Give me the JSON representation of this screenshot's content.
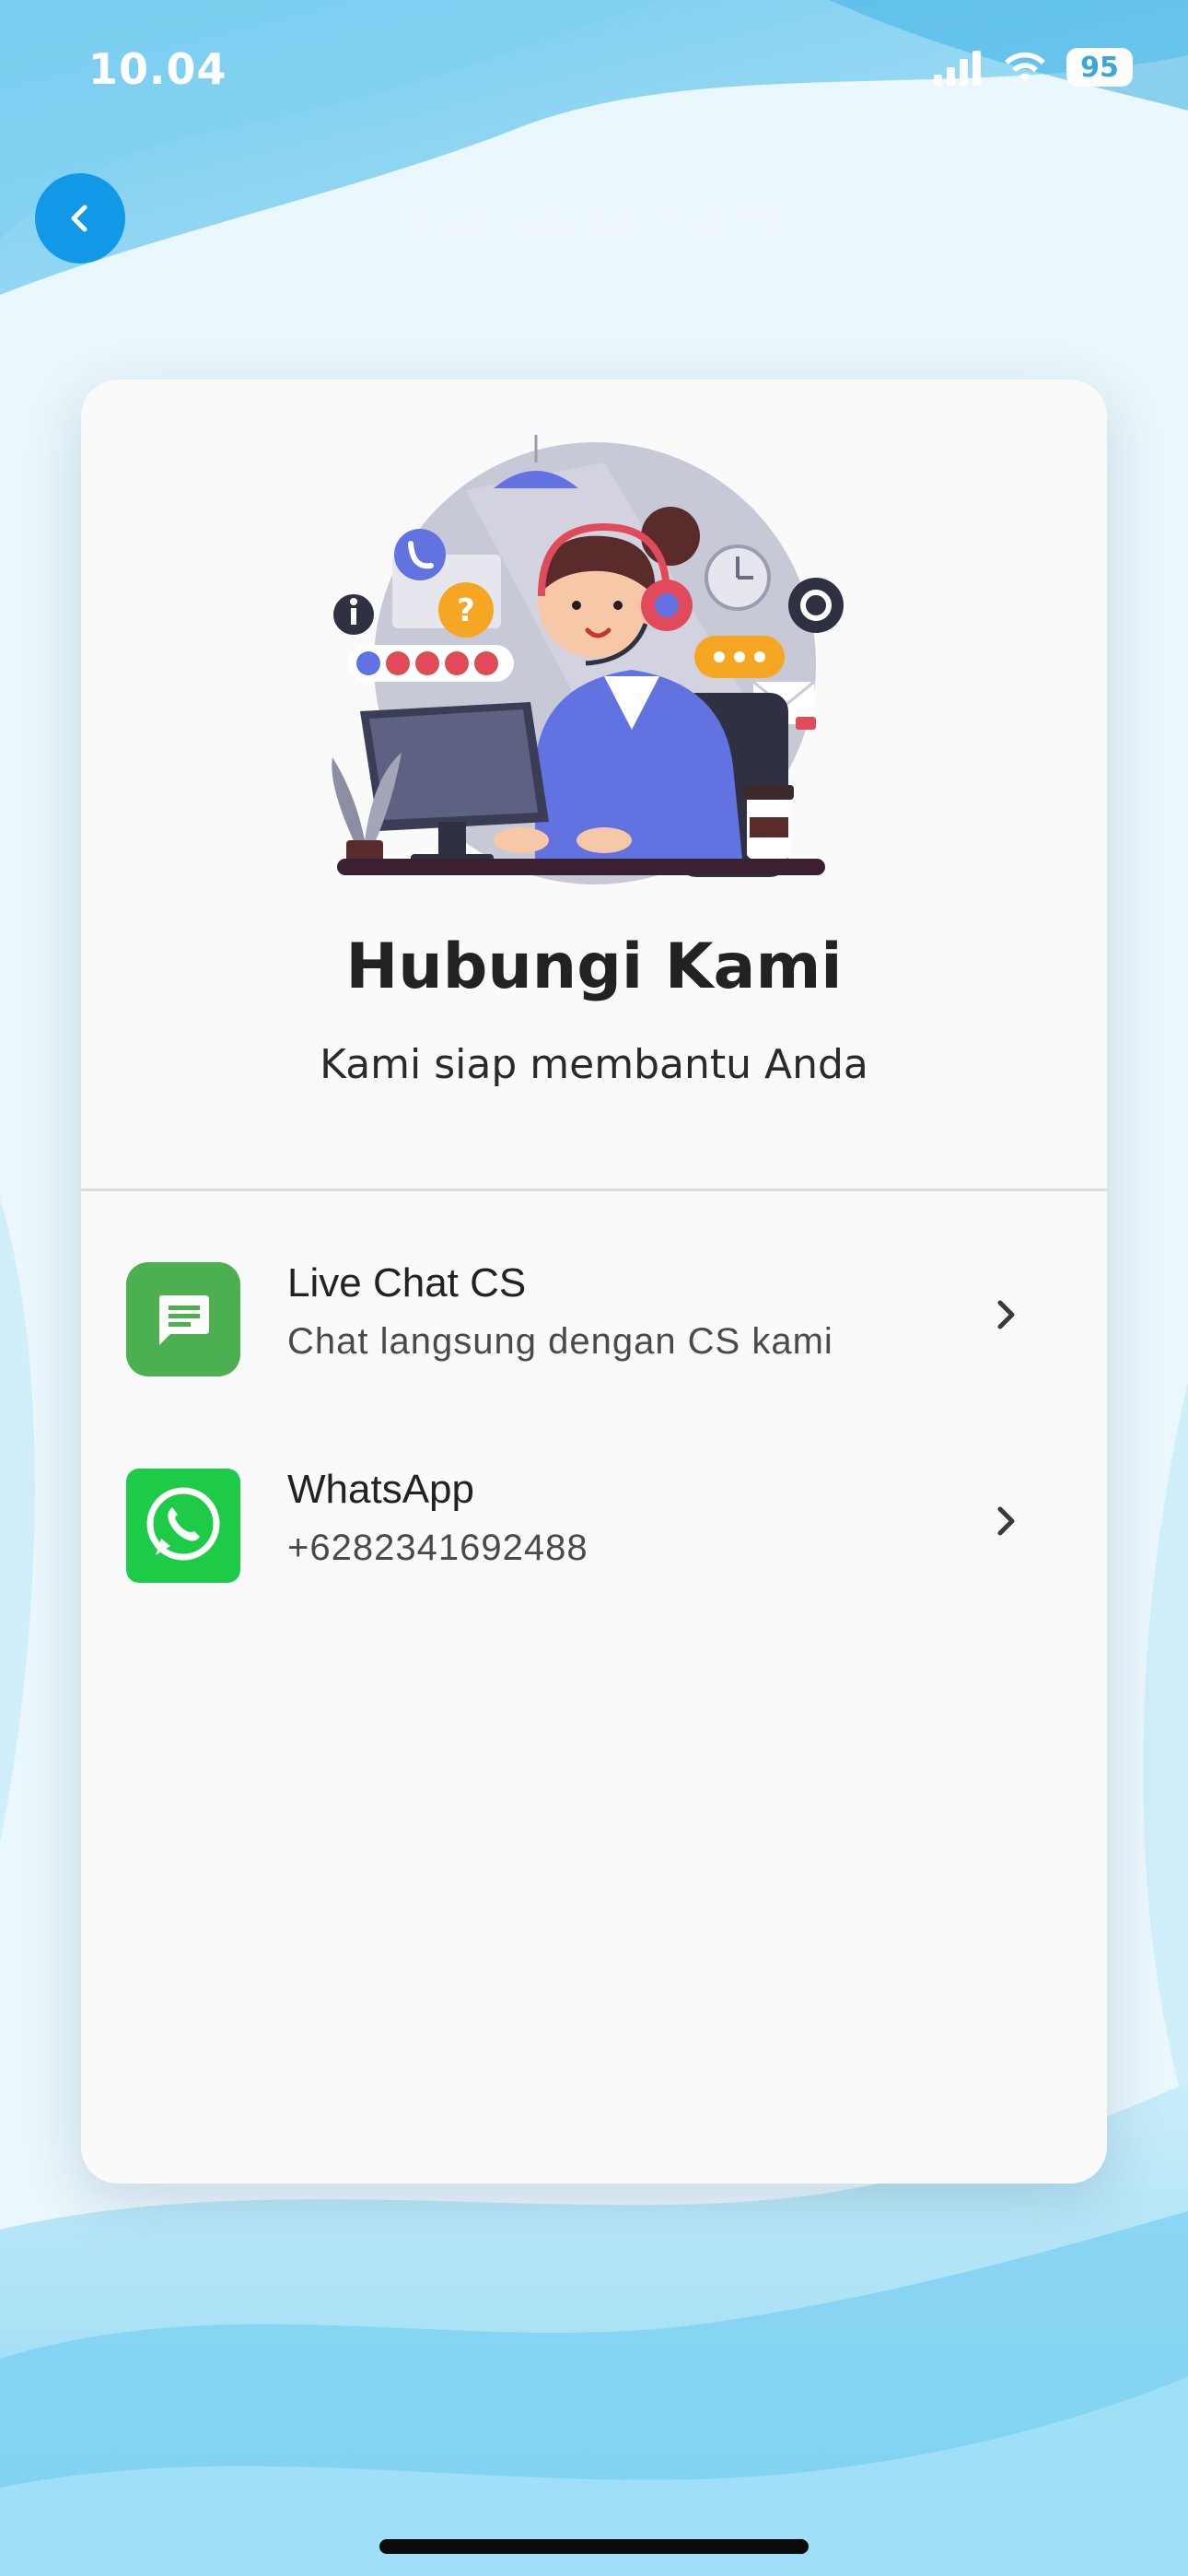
{
  "status_bar": {
    "time": "10.04",
    "battery": "95",
    "icons": [
      "cellular-signal-icon",
      "wifi-icon",
      "battery-icon"
    ]
  },
  "header": {
    "title": "Hubungi Kami",
    "back_icon": "chevron-left-icon"
  },
  "card": {
    "title": "Hubungi Kami",
    "subtitle": "Kami siap membantu Anda",
    "illustration": "customer-service-illustration"
  },
  "contacts": [
    {
      "label": "Live Chat CS",
      "sub": "Chat langsung dengan CS kami",
      "icon": "chat-message-icon"
    },
    {
      "label": "WhatsApp",
      "sub": "+6282341692488",
      "icon": "whatsapp-icon"
    }
  ],
  "colors": {
    "accent": "#1199e8",
    "chat_green": "#4caf50",
    "whatsapp_green": "#1ecb47",
    "card_bg": "#fafafa"
  }
}
